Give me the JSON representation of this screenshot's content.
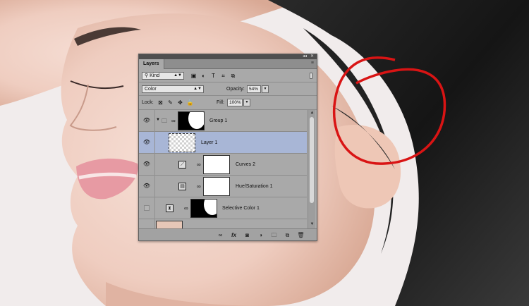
{
  "panel": {
    "title": "Layers",
    "filter": {
      "value": "Kind",
      "icons": [
        "image-filter-icon",
        "adjustment-filter-icon",
        "type-filter-icon",
        "shape-filter-icon",
        "smart-object-filter-icon"
      ]
    },
    "blend_mode": "Color",
    "opacity": {
      "label": "Opacity:",
      "value": "54%"
    },
    "lock": {
      "label": "Lock:",
      "icons": [
        "lock-transparent-icon",
        "lock-image-icon",
        "lock-position-icon",
        "lock-all-icon"
      ]
    },
    "fill": {
      "label": "Fill:",
      "value": "100%"
    },
    "layers": [
      {
        "name": "Group 1",
        "visible": true,
        "type": "group"
      },
      {
        "name": "Layer 1",
        "visible": true,
        "type": "pixel",
        "selected": true
      },
      {
        "name": "Curves 2",
        "visible": true,
        "type": "curves"
      },
      {
        "name": "Hue/Saturation 1",
        "visible": true,
        "type": "hue-saturation"
      },
      {
        "name": "Selective Color 1",
        "visible": false,
        "type": "selective-color"
      }
    ],
    "bottom_icons": [
      "link-layers-icon",
      "fx-icon",
      "add-mask-icon",
      "new-adjustment-icon",
      "new-group-icon",
      "new-layer-icon",
      "trash-icon"
    ],
    "glyphs": {
      "eye": "👁",
      "chain": "∞",
      "fx": "fx",
      "trash": "🗑",
      "collapse": "◂◂",
      "close": "✕",
      "menu": "≡",
      "expand": "▼"
    }
  },
  "colors": {
    "annotation_circle": "#d91414",
    "selection": "#a8b6d6"
  }
}
